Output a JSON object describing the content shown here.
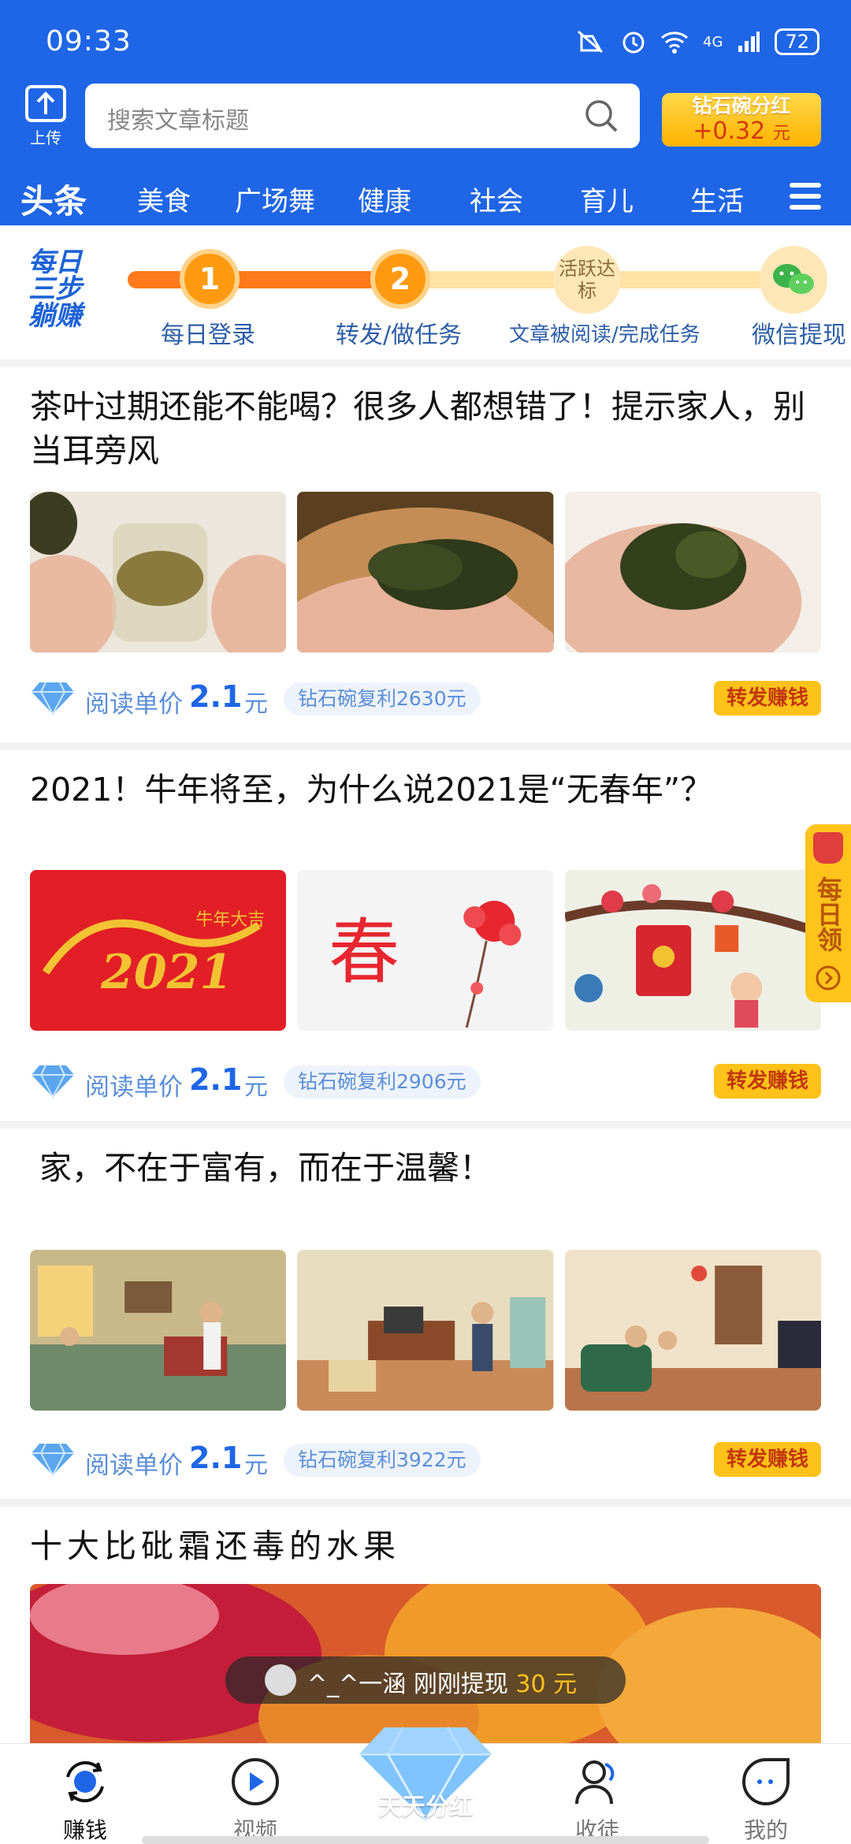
{
  "status": {
    "time": "09:33",
    "network": "4G",
    "battery": "72"
  },
  "header": {
    "upload_label": "上传",
    "search_placeholder": "搜索文章标题",
    "promo_title": "钻石碗分红",
    "promo_value": "+0.32",
    "promo_unit": "元"
  },
  "tabs": [
    "头条",
    "美食",
    "广场舞",
    "健康",
    "社会",
    "育儿",
    "生活"
  ],
  "steps": {
    "logo_text": "每日三步躺赚",
    "items": [
      {
        "num": "1",
        "label": "每日登录"
      },
      {
        "num": "2",
        "label": "转发/做任务"
      },
      {
        "num": "活跃达标",
        "label": "文章被阅读/完成任务"
      },
      {
        "num": "",
        "label": "微信提现"
      }
    ]
  },
  "articles": [
    {
      "title": "茶叶过期还能不能喝？很多人都想错了！提示家人，别当耳旁风",
      "price_label": "阅读单价",
      "price": "2.1",
      "unit": "元",
      "bonus": "钻石碗复利2630元",
      "forward": "转发赚钱"
    },
    {
      "title": "2021！牛年将至，为什么说2021是“无春年”？",
      "price_label": "阅读单价",
      "price": "2.1",
      "unit": "元",
      "bonus": "钻石碗复利2906元",
      "forward": "转发赚钱",
      "image_text": [
        "2021",
        "牛年大吉",
        "春"
      ]
    },
    {
      "title": "家，不在于富有，而在于温馨！",
      "price_label": "阅读单价",
      "price": "2.1",
      "unit": "元",
      "bonus": "钻石碗复利3922元",
      "forward": "转发赚钱"
    },
    {
      "title": "十大比砒霜还毒的水果"
    }
  ],
  "side_widget": {
    "label": "每日领"
  },
  "toast": {
    "user": "^_^一涵",
    "text": "刚刚提现",
    "amount": "30",
    "unit": "元"
  },
  "bottom_nav": [
    {
      "label": "赚钱",
      "icon": "refresh-coin-icon"
    },
    {
      "label": "视频",
      "icon": "play-icon"
    },
    {
      "label": "天天分红",
      "icon": "diamond-icon"
    },
    {
      "label": "收徒",
      "icon": "user-add-icon"
    },
    {
      "label": "我的",
      "icon": "profile-face-icon"
    }
  ],
  "colors": {
    "primary": "#1e66e6",
    "accent": "#ffc21a",
    "progress": "#ff7a1a"
  }
}
